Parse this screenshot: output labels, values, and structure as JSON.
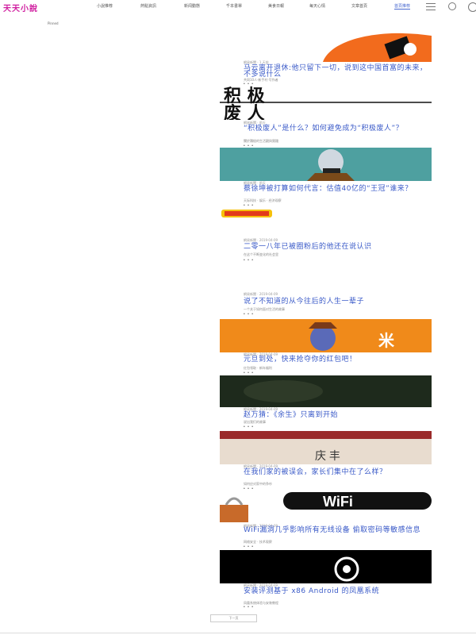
{
  "site": {
    "logo": "天天小說",
    "section_label": "Pinned"
  },
  "nav": [
    "小說推荐",
    "熱點資訊",
    "新闻動態",
    "千本書單",
    "美食日報",
    "每天心情",
    "文章首頁",
    "首頁推荐"
  ],
  "articles": [
    {
      "meta": "網易新聞 · 1 天前",
      "title": "马云离开退休:他只留下一切，说到这中国首富的未来，不多说什么",
      "summary": "共同10人·新手村·写作者",
      "dots": "• • •"
    },
    {
      "meta": "網易新聞 · 前天",
      "title": "“积极废人”是什么？如何避免成为“积极废人”？",
      "summary": "關於積極的生活觀與實踐",
      "dots": "• • •"
    },
    {
      "meta": "網易新聞 · 前天",
      "title": "蔡徐坤被打算如何代言：估值40亿的“王冠”谁来？",
      "summary": "天际科技 · 娱乐 · 经济观察",
      "dots": "• • •"
    },
    {
      "meta": "網易新聞 · 2019-04-09",
      "title": "二零一八年已被圈粉后的他还在说认识",
      "summary": "在这个不断变化的社会里",
      "dots": "• • •"
    },
    {
      "meta": "網易新聞 · 2019-04-09",
      "title": "说了不知道的从今往后的人生一辈子",
      "summary": "一个关于如何面对生活的故事",
      "dots": "• • •"
    },
    {
      "meta": "網易新聞 · 2019-04-09",
      "title": "元旦到处，快来抢夺你的红包吧！",
      "summary": "红包领取 · 新年福利",
      "dots": "• • •"
    },
    {
      "meta": "網易新聞 · 2019-04-09",
      "title": "赵万猜：《余生》只离到开始",
      "summary": "说出我们的故事",
      "dots": "• • •"
    },
    {
      "meta": "網易新聞 · 2019-04-09",
      "title": "在我们家的被误会，家长们集中在了么样？",
      "summary": "如何应对家中的争吵",
      "dots": "• • •"
    },
    {
      "meta": "網易新聞 · 2019-04-09",
      "title": "WiFi漏洞几乎影响所有无线设备 偷取密码等敏感信息",
      "summary": "网络安全 · 技术观察",
      "dots": "• • •"
    },
    {
      "meta": "網易新聞 · 2019-04-09",
      "title": "安装评测基于 x86 Android 的凤凰系统",
      "summary": "凤凰系统体验与安装教程",
      "dots": "• • •"
    }
  ],
  "pager": {
    "label": "下一页"
  },
  "colors": {
    "accent": "#3a5ac8",
    "logo": "#d020a0"
  }
}
